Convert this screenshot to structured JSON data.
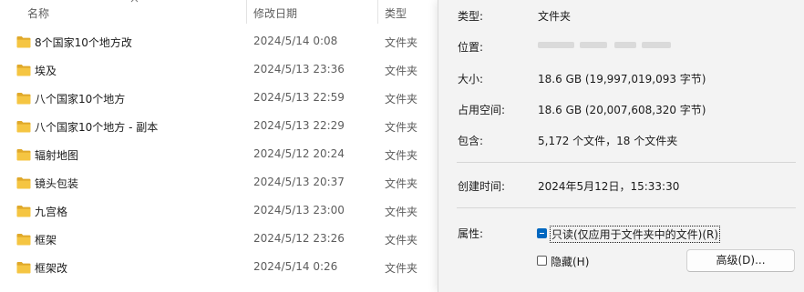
{
  "explorer": {
    "headers": {
      "name": "名称",
      "date": "修改日期",
      "type": "类型"
    },
    "rows": [
      {
        "name": "8个国家10个地方改",
        "date": "2024/5/14 0:08",
        "type": "文件夹"
      },
      {
        "name": "埃及",
        "date": "2024/5/13 23:36",
        "type": "文件夹"
      },
      {
        "name": "八个国家10个地方",
        "date": "2024/5/13 22:59",
        "type": "文件夹"
      },
      {
        "name": "八个国家10个地方 - 副本",
        "date": "2024/5/13 22:29",
        "type": "文件夹"
      },
      {
        "name": "辐射地图",
        "date": "2024/5/12 20:24",
        "type": "文件夹"
      },
      {
        "name": "镜头包装",
        "date": "2024/5/13 20:37",
        "type": "文件夹"
      },
      {
        "name": "九宫格",
        "date": "2024/5/13 23:00",
        "type": "文件夹"
      },
      {
        "name": "框架",
        "date": "2024/5/12 23:26",
        "type": "文件夹"
      },
      {
        "name": "框架改",
        "date": "2024/5/14 0:26",
        "type": "文件夹"
      }
    ]
  },
  "properties": {
    "type_label": "类型:",
    "type_value": "文件夹",
    "location_label": "位置:",
    "size_label": "大小:",
    "size_value": "18.6 GB (19,997,019,093 字节)",
    "disk_label": "占用空间:",
    "disk_value": "18.6 GB (20,007,608,320 字节)",
    "contains_label": "包含:",
    "contains_value": "5,172 个文件，18 个文件夹",
    "created_label": "创建时间:",
    "created_value": "2024年5月12日，15:33:30",
    "attributes_label": "属性:",
    "readonly_label": "只读(仅应用于文件夹中的文件)(R)",
    "hidden_label": "隐藏(H)",
    "advanced_button": "高级(D)..."
  },
  "colors": {
    "folder": "#f5c542",
    "accent": "#0067c0"
  },
  "icons": {
    "folder": "folder-icon",
    "sort": "chevron-up-icon"
  }
}
